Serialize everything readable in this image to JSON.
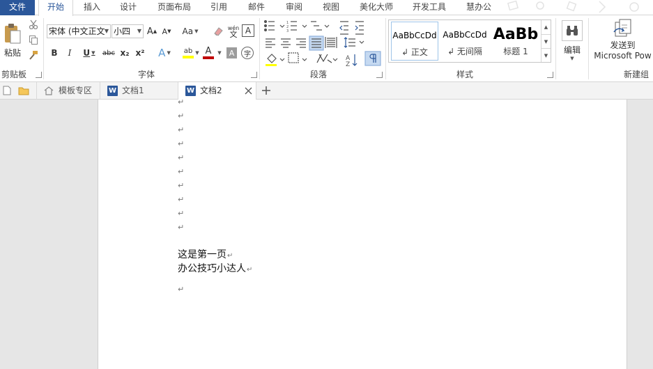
{
  "ribbon_tabs": [
    "文件",
    "开始",
    "插入",
    "设计",
    "页面布局",
    "引用",
    "邮件",
    "审阅",
    "视图",
    "美化大师",
    "开发工具",
    "慧办公"
  ],
  "active_tab": "开始",
  "clipboard": {
    "paste_label": "粘贴",
    "group_label": "剪贴板"
  },
  "font": {
    "font_name": "宋体 (中文正文",
    "font_size": "小四",
    "grow_label": "A",
    "shrink_label": "A",
    "case_label": "Aa",
    "phonetic_label": "wén",
    "border_char_label": "A",
    "bold": "B",
    "italic": "I",
    "underline": "U",
    "strike": "abc",
    "sub": "x₂",
    "sup": "x²",
    "effects": "A",
    "highlight": "ab",
    "color": "A",
    "shading": "A",
    "enclose": "字",
    "group_label": "字体"
  },
  "paragraph": {
    "group_label": "段落"
  },
  "styles": {
    "items": [
      {
        "sample": "AaBbCcDd",
        "name": "↲ 正文"
      },
      {
        "sample": "AaBbCcDd",
        "name": "↲ 无间隔"
      },
      {
        "sample": "AaBb",
        "name": "标题 1"
      }
    ],
    "group_label": "样式"
  },
  "editing": {
    "label": "编辑"
  },
  "new_group": {
    "send_line1": "发送到",
    "send_line2": "Microsoft Pow",
    "group_label": "新建组"
  },
  "doc_tabs": {
    "template": "模板专区",
    "doc1": "文档1",
    "doc2": "文档2",
    "word_letter": "W"
  },
  "document": {
    "empty_marks": [
      "↵",
      "↵",
      "↵",
      "↵",
      "↵",
      "↵",
      "↵",
      "↵",
      "↵",
      "↵"
    ],
    "line1": "这是第一页",
    "line2": "办公技巧小达人",
    "mark": "↵"
  },
  "colors": {
    "accent": "#2b579a",
    "highlight_yellow": "#ffff00",
    "font_red": "#c00000"
  }
}
